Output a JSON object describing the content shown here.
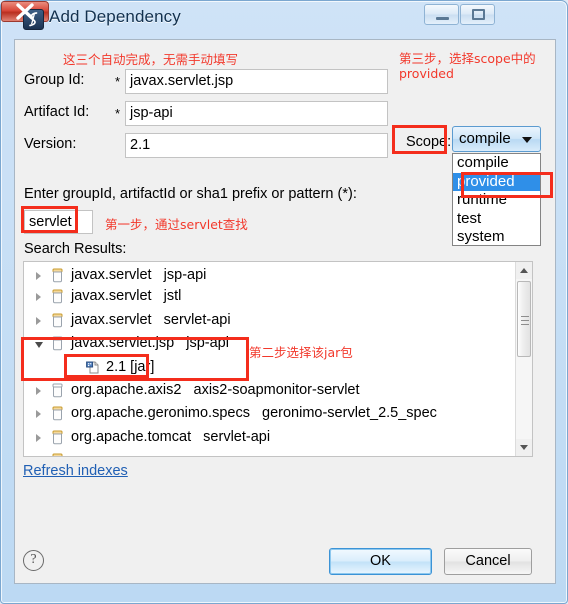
{
  "window": {
    "title": "Add Dependency",
    "icon": "maven-dependency-icon",
    "controls": {
      "minimize": "minimize-button",
      "maximize": "maximize-button",
      "close": "close-button"
    }
  },
  "form": {
    "group_id": {
      "label": "Group Id:",
      "required_mark": "*",
      "value": "javax.servlet.jsp"
    },
    "artifact_id": {
      "label": "Artifact Id:",
      "required_mark": "*",
      "value": "jsp-api"
    },
    "version": {
      "label": "Version:",
      "required_mark": "",
      "value": "2.1"
    },
    "scope": {
      "label": "Scope:",
      "selected": "compile",
      "options": [
        "compile",
        "provided",
        "runtime",
        "test",
        "system"
      ],
      "highlighted_option": "provided"
    }
  },
  "search": {
    "prompt": "Enter groupId, artifactId or sha1 prefix or pattern (*):",
    "value": "servlet",
    "placeholder": "",
    "results_label": "Search Results:"
  },
  "results": [
    {
      "group": "javax.servlet",
      "artifact": "jsp-api",
      "expanded": false,
      "icon": "jar-icon"
    },
    {
      "group": "javax.servlet",
      "artifact": "jstl",
      "expanded": false,
      "icon": "jar-icon"
    },
    {
      "group": "javax.servlet",
      "artifact": "servlet-api",
      "expanded": false,
      "icon": "jar-icon"
    },
    {
      "group": "javax.servlet.jsp",
      "artifact": "jsp-api",
      "expanded": true,
      "icon": "jar-icon",
      "children": [
        {
          "label": "2.1 [jar]",
          "icon": "jar-file-icon"
        }
      ]
    },
    {
      "group": "org.apache.axis2",
      "artifact": "axis2-soapmonitor-servlet",
      "expanded": false,
      "icon": "jar-icon"
    },
    {
      "group": "org.apache.geronimo.specs",
      "artifact": "geronimo-servlet_2.5_spec",
      "expanded": false,
      "icon": "jar-icon"
    },
    {
      "group": "org.apache.tomcat",
      "artifact": "servlet-api",
      "expanded": false,
      "icon": "jar-icon"
    }
  ],
  "links": {
    "refresh_indexes": "Refresh indexes"
  },
  "buttons": {
    "help": "?",
    "ok": "OK",
    "cancel": "Cancel"
  },
  "annotations": {
    "autofill": "这三个自动完成，无需手动填写",
    "step3_line1": "第三步，选择scope中的",
    "step3_line2": "provided",
    "step1": "第一步，通过servlet查找",
    "step2": "第二步选择该jar包"
  },
  "colors": {
    "annotation_red": "#f2392c",
    "highlight_box": "#f42d1c",
    "selection_blue": "#2f8fe8",
    "link_blue": "#2160b4"
  }
}
